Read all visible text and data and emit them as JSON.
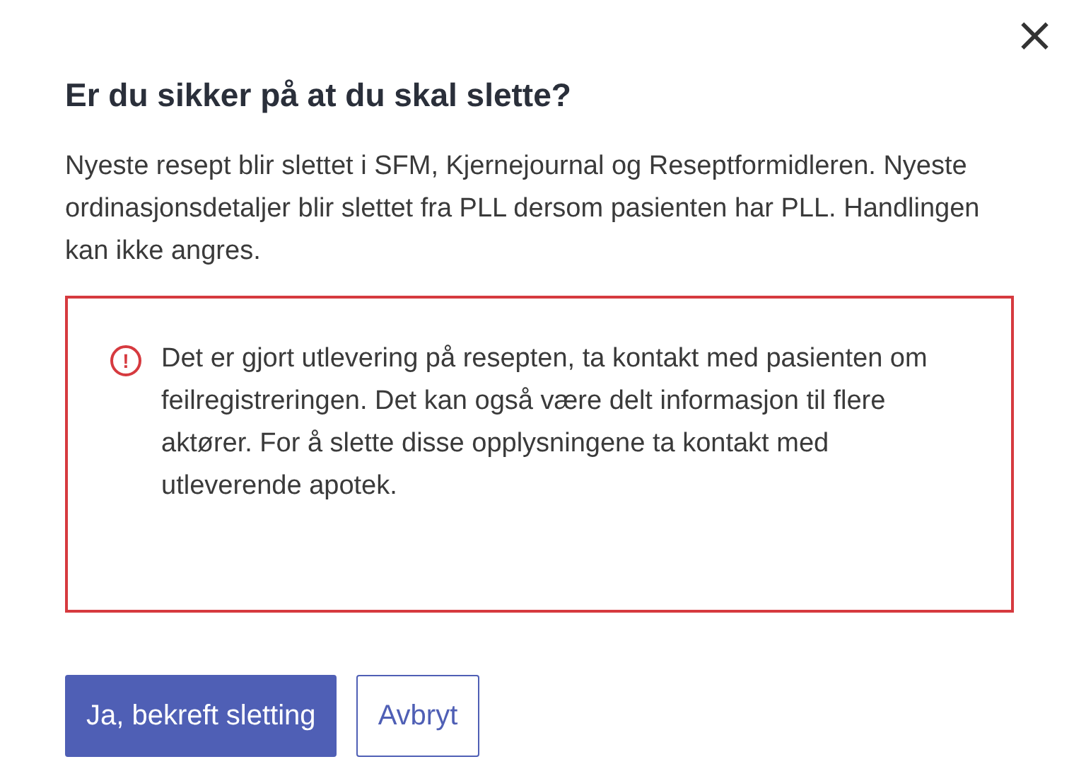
{
  "dialog": {
    "close": "×",
    "title": "Er du sikker på at du skal slette?",
    "body": "Nyeste resept blir slettet i SFM, Kjernejournal og Reseptformidleren. Nyeste ordinasjonsdetaljer blir slettet fra PLL dersom pasienten har PLL. Handlingen kan ikke angres.",
    "alert": {
      "kind": "error",
      "icon": "!",
      "text": "Det er gjort utlevering på resepten, ta kontakt med pasienten om feilregistreringen. Det kan også være delt informasjon til flere aktører. For å slette disse opplysningene ta kontakt med utleverende apotek."
    },
    "buttons": [
      {
        "kind": "primary",
        "label": "Ja, bekreft sletting"
      },
      {
        "kind": "secondary",
        "label": "Avbryt"
      }
    ]
  }
}
